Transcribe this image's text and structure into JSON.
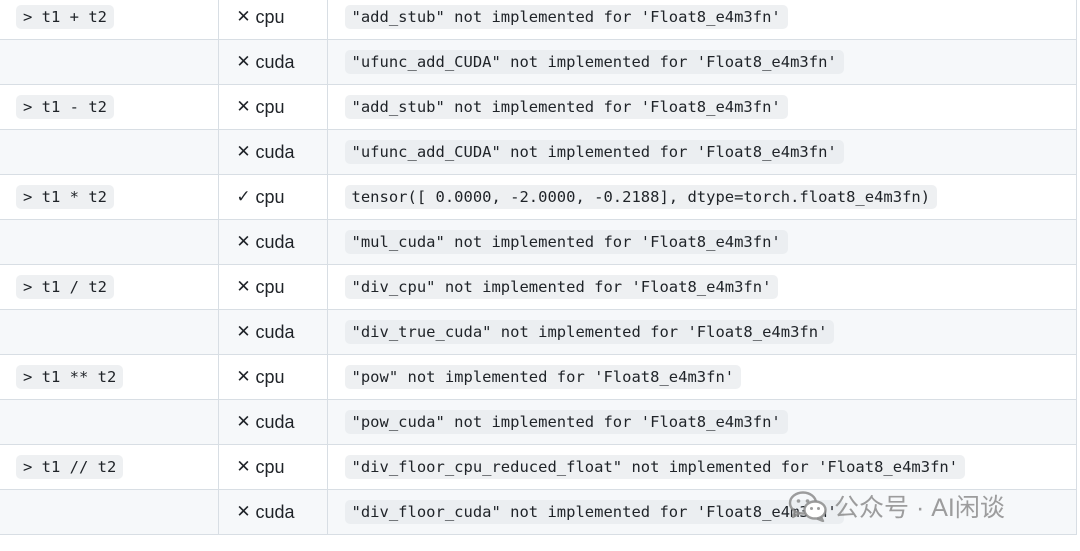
{
  "rows": [
    {
      "expr": "> t1 + t2",
      "device": "cpu",
      "ok": false,
      "message": "\"add_stub\" not implemented for 'Float8_e4m3fn'"
    },
    {
      "expr": "",
      "device": "cuda",
      "ok": false,
      "message": "\"ufunc_add_CUDA\" not implemented for 'Float8_e4m3fn'"
    },
    {
      "expr": "> t1 - t2",
      "device": "cpu",
      "ok": false,
      "message": "\"add_stub\" not implemented for 'Float8_e4m3fn'"
    },
    {
      "expr": "",
      "device": "cuda",
      "ok": false,
      "message": "\"ufunc_add_CUDA\" not implemented for 'Float8_e4m3fn'"
    },
    {
      "expr": "> t1 * t2",
      "device": "cpu",
      "ok": true,
      "message": "tensor([ 0.0000, -2.0000, -0.2188], dtype=torch.float8_e4m3fn)"
    },
    {
      "expr": "",
      "device": "cuda",
      "ok": false,
      "message": "\"mul_cuda\" not implemented for 'Float8_e4m3fn'"
    },
    {
      "expr": "> t1 / t2",
      "device": "cpu",
      "ok": false,
      "message": "\"div_cpu\" not implemented for 'Float8_e4m3fn'"
    },
    {
      "expr": "",
      "device": "cuda",
      "ok": false,
      "message": "\"div_true_cuda\" not implemented for 'Float8_e4m3fn'"
    },
    {
      "expr": "> t1 ** t2",
      "device": "cpu",
      "ok": false,
      "message": "\"pow\" not implemented for 'Float8_e4m3fn'"
    },
    {
      "expr": "",
      "device": "cuda",
      "ok": false,
      "message": "\"pow_cuda\" not implemented for 'Float8_e4m3fn'"
    },
    {
      "expr": "> t1 // t2",
      "device": "cpu",
      "ok": false,
      "message": "\"div_floor_cpu_reduced_float\" not implemented for 'Float8_e4m3fn'"
    },
    {
      "expr": "",
      "device": "cuda",
      "ok": false,
      "message": "\"div_floor_cuda\" not implemented for 'Float8_e4m3fn'"
    }
  ],
  "marks": {
    "ok": "✓",
    "fail": "✕"
  },
  "watermark": {
    "icon": "wechat-icon",
    "text": "公众号 · AI闲谈"
  },
  "colors": {
    "border": "#d8dee4",
    "alt_row": "#f6f8fa",
    "code_bg": "#eef0f2",
    "text": "#1f2328"
  }
}
